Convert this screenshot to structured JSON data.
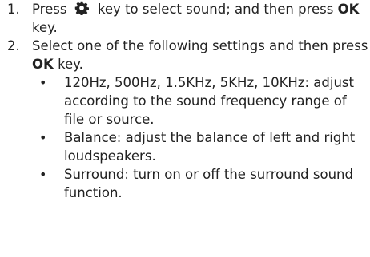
{
  "steps": [
    {
      "number": "1.",
      "text_before_icon": "Press",
      "icon": "gear-icon",
      "text_after_icon": "key to select sound; and then press",
      "key": "OK",
      "text_end": "key."
    },
    {
      "number": "2.",
      "text_before_key": "Select one of the following settings and then press",
      "key": "OK",
      "text_end": "key.",
      "options": [
        {
          "bullet": "•",
          "text": "120Hz, 500Hz, 1.5KHz, 5KHz, 10KHz: adjust according to the sound frequency range of file or source."
        },
        {
          "bullet": "•",
          "text": "Balance: adjust the balance of left and right loudspeakers."
        },
        {
          "bullet": "•",
          "text": "Surround: turn on or off the surround sound function."
        }
      ]
    }
  ],
  "colors": {
    "text": "#222222",
    "background": "#ffffff"
  }
}
